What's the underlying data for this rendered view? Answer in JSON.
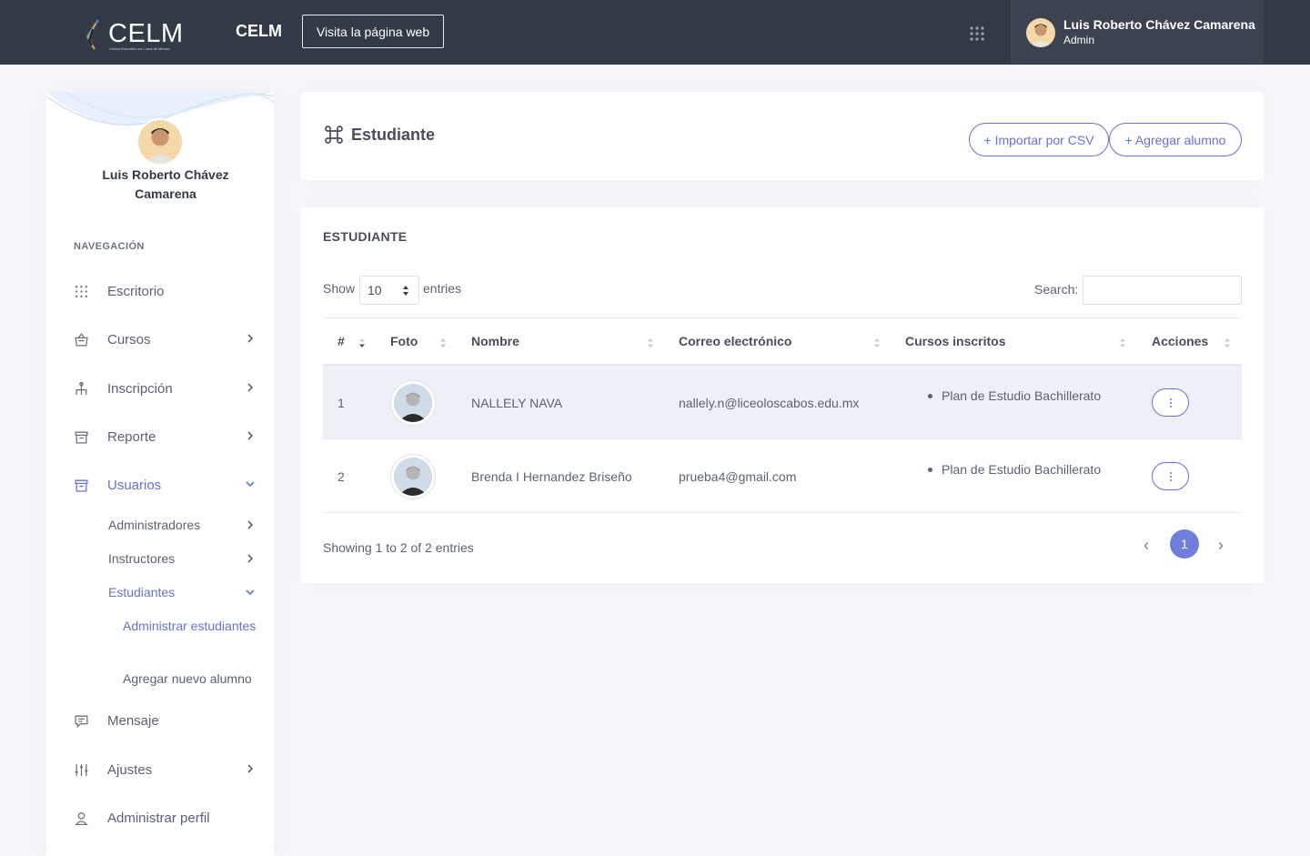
{
  "topbar": {
    "logo_text": "CELM",
    "logo_subtitle": "Centro Educativo en Línea de México",
    "brand": "CELM",
    "website_button": "Visita la página web",
    "user_name": "Luis Roberto Chávez Camarena",
    "user_role": "Admin"
  },
  "sidebar": {
    "profile_name": "Luis Roberto Chávez Camarena",
    "nav_title": "NAVEGACIÓN",
    "items": {
      "escritorio": "Escritorio",
      "cursos": "Cursos",
      "inscripcion": "Inscripción",
      "reporte": "Reporte",
      "usuarios": "Usuarios",
      "administradores": "Administradores",
      "instructores": "Instructores",
      "estudiantes": "Estudiantes",
      "administrar_estudiantes": "Administrar estudiantes",
      "agregar_nuevo_alumno": "Agregar nuevo alumno",
      "mensaje": "Mensaje",
      "ajustes": "Ajustes",
      "administrar_perfil": "Administrar perfil"
    }
  },
  "header": {
    "title": "Estudiante",
    "import_button": "+ Importar por CSV",
    "add_button": "+ Agregar alumno"
  },
  "table_card": {
    "title": "ESTUDIANTE",
    "show_label": "Show",
    "entries_value": "10",
    "entries_label": "entries",
    "search_label": "Search:",
    "search_value": "",
    "columns": [
      "#",
      "Foto",
      "Nombre",
      "Correo electrónico",
      "Cursos inscritos",
      "Acciones"
    ],
    "rows": [
      {
        "num": "1",
        "name": "NALLELY NAVA",
        "email": "nallely.n@liceoloscabos.edu.mx",
        "course": "Plan de Estudio Bachillerato"
      },
      {
        "num": "2",
        "name": "Brenda I Hernandez Briseño",
        "email": "prueba4@gmail.com",
        "course": "Plan de Estudio Bachillerato"
      }
    ],
    "info": "Showing 1 to 2 of 2 entries",
    "page": "1"
  },
  "colors": {
    "topbar": "#323a46",
    "accent": "#6572d6",
    "page_bg": "#f6f7fb"
  }
}
